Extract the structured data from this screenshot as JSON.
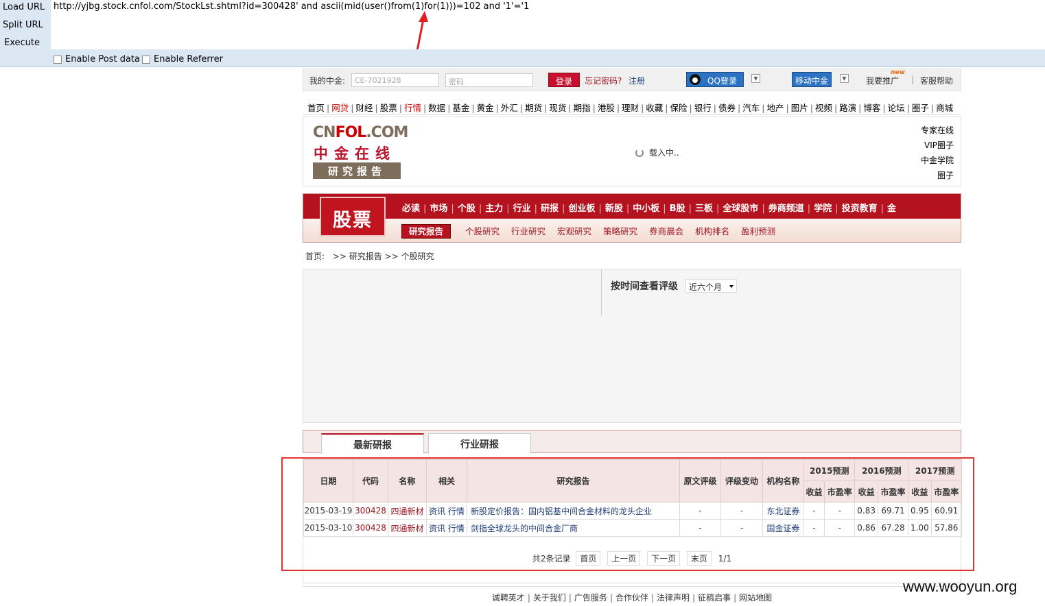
{
  "hackbar": {
    "load_url": "Load URL",
    "split_url": "Split URL",
    "execute": "Execute",
    "url": "http://yjbg.stock.cnfol.com/StockLst.shtml?id=300428'  and  ascii(mid(user()from(1)for(1)))=102 and '1'='1",
    "post_data": "Enable Post data",
    "referrer": "Enable Referrer"
  },
  "topbar": {
    "my_label": "我的中金:",
    "user_placeholder": "CE-7021928",
    "pwd_placeholder": "密码",
    "login": "登录",
    "forgot": "忘记密码?",
    "register": "注册",
    "qq_login": "QQ登录",
    "mobile": "移动中金",
    "promote": "我要推广",
    "new_badge": "new",
    "help": "客服帮助"
  },
  "nav1": [
    "首页",
    "网贷",
    "财经",
    "股票",
    "行情",
    "数据",
    "基金",
    "黄金",
    "外汇",
    "期货",
    "现货",
    "期指",
    "港股",
    "理财",
    "收藏",
    "保险",
    "银行",
    "债券",
    "汽车",
    "地产",
    "图片",
    "视频",
    "路演",
    "博客",
    "论坛",
    "圈子",
    "商城"
  ],
  "logo": {
    "line1_a": "CN",
    "line1_b": "FOL",
    "line1_c": ".COM",
    "line2": "中金在线",
    "line3": "研究报告",
    "loading": "载入中..",
    "right_links": [
      "专家在线",
      "VIP圈子",
      "中金学院",
      "圈子"
    ]
  },
  "stock": {
    "title": "股票",
    "nav": [
      "必读",
      "市场",
      "个股",
      "主力",
      "行业",
      "研报",
      "创业板",
      "新股",
      "中小板",
      "B股",
      "三板",
      "全球股市",
      "券商频道",
      "学院",
      "投资教育",
      "金"
    ],
    "active_sub": "研究报告",
    "subs": [
      "个股研究",
      "行业研究",
      "宏观研究",
      "策略研究",
      "券商晨会",
      "机构排名",
      "盈利预测"
    ]
  },
  "breadcrumb": {
    "home": "首页:",
    "sep1": ">>",
    "level1": "研究报告",
    "sep2": ">>",
    "level2": "个股研究"
  },
  "rating": {
    "label": "按时间查看评级",
    "select_value": "近六个月"
  },
  "tabs": {
    "latest": "最新研报",
    "industry": "行业研报"
  },
  "table": {
    "headers": {
      "date": "日期",
      "code": "代码",
      "name": "名称",
      "related": "相关",
      "report": "研究报告",
      "orig_rating": "原文评级",
      "rating_change": "评级变动",
      "org": "机构名称",
      "y2015": "2015预测",
      "y2016": "2016预测",
      "y2017": "2017预测",
      "eps": "收益",
      "pe": "市盈率"
    },
    "rows": [
      {
        "date": "2015-03-19",
        "code": "300428",
        "name": "四通新材",
        "rel1": "资讯",
        "rel2": "行情",
        "report": "新股定价报告：国内铝基中间合金材料的龙头企业",
        "orig": "-",
        "change": "-",
        "org": "东北证券",
        "e15": "-",
        "p15": "-",
        "e16": "0.83",
        "p16": "69.71",
        "e17": "0.95",
        "p17": "60.91"
      },
      {
        "date": "2015-03-10",
        "code": "300428",
        "name": "四通新材",
        "rel1": "资讯",
        "rel2": "行情",
        "report": "剑指全球龙头的中间合金厂商",
        "orig": "-",
        "change": "-",
        "org": "国金证券",
        "e15": "-",
        "p15": "-",
        "e16": "0.86",
        "p16": "67.28",
        "e17": "1.00",
        "p17": "57.86"
      }
    ]
  },
  "pager": {
    "total": "共2条记录",
    "first": "首页",
    "prev": "上一页",
    "next": "下一页",
    "last": "末页",
    "page": "1/1"
  },
  "footer": [
    "诚聘英才",
    "关于我们",
    "广告服务",
    "合作伙伴",
    "法律声明",
    "征稿启事",
    "网站地图"
  ],
  "watermark": "www.wooyun.org",
  "colors": {
    "accent_red": "#b5121f",
    "hackbar_bg": "#dce7f4",
    "highlight_box": "#e53333"
  }
}
